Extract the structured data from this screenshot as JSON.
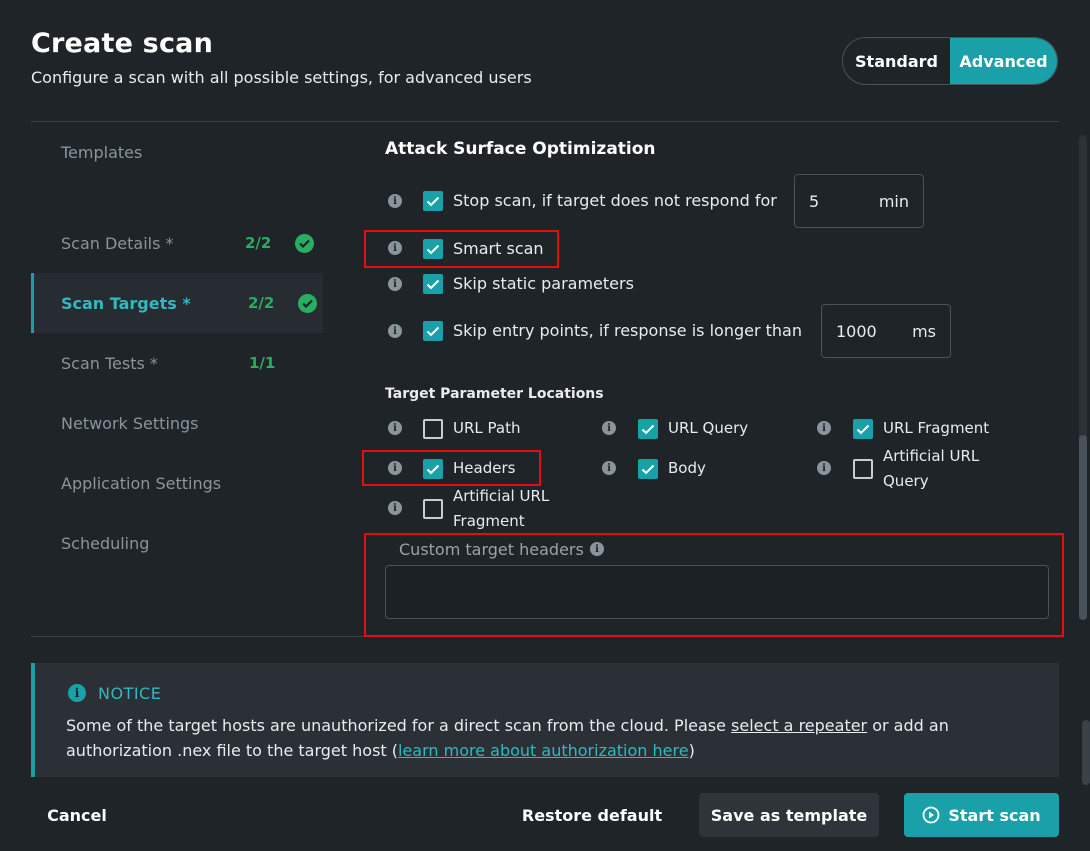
{
  "header": {
    "title": "Create scan",
    "subtitle": "Configure a scan with all possible settings, for advanced users",
    "mode_standard": "Standard",
    "mode_advanced": "Advanced",
    "active_mode": "Advanced"
  },
  "sidebar": {
    "items": [
      {
        "label": "Templates",
        "count": "",
        "complete": false,
        "active": false
      },
      {
        "label": "Scan Details *",
        "count": "2/2",
        "complete": true,
        "active": false
      },
      {
        "label": "Scan Targets *",
        "count": "2/2",
        "complete": true,
        "active": true
      },
      {
        "label": "Scan Tests *",
        "count": "1/1",
        "complete": false,
        "active": false
      },
      {
        "label": "Network Settings",
        "count": "",
        "complete": false,
        "active": false
      },
      {
        "label": "Application Settings",
        "count": "",
        "complete": false,
        "active": false
      },
      {
        "label": "Scheduling",
        "count": "",
        "complete": false,
        "active": false
      }
    ]
  },
  "main": {
    "section_title": "Attack Surface Optimization",
    "options": {
      "stop_scan": {
        "label": "Stop scan, if target does not respond for",
        "checked": true,
        "value": "5",
        "unit": "min"
      },
      "smart_scan": {
        "label": "Smart scan",
        "checked": true
      },
      "skip_static": {
        "label": "Skip static parameters",
        "checked": true
      },
      "skip_entry": {
        "label": "Skip entry points, if response is longer than",
        "checked": true,
        "value": "1000",
        "unit": "ms"
      }
    },
    "locations_title": "Target Parameter Locations",
    "locations": {
      "url_path": {
        "label": "URL Path",
        "checked": false
      },
      "url_query": {
        "label": "URL Query",
        "checked": true
      },
      "url_fragment": {
        "label": "URL Fragment",
        "checked": true
      },
      "headers": {
        "label": "Headers",
        "checked": true
      },
      "body": {
        "label": "Body",
        "checked": true
      },
      "artificial_url_query_1": "Artificial URL",
      "artificial_url_query_2": "Query",
      "artificial_url_query_checked": false,
      "artificial_url_fragment_1": "Artificial URL",
      "artificial_url_fragment_2": "Fragment",
      "artificial_url_fragment_checked": false
    },
    "custom_headers_label": "Custom target headers",
    "custom_headers_value": ""
  },
  "notice": {
    "title": "NOTICE",
    "text_1": "Some of the target hosts are unauthorized for a direct scan from the cloud. Please ",
    "link_1": "select a repeater",
    "text_2": " or add an authorization .nex file to the target host (",
    "link_2": "learn more about authorization here",
    "text_3": ")"
  },
  "footer": {
    "cancel": "Cancel",
    "restore": "Restore default",
    "save_template": "Save as template",
    "start_scan": "Start scan"
  },
  "colors": {
    "accent": "#1aa0a8",
    "success": "#27ae60",
    "highlight": "#e01010",
    "background": "#1f2428"
  },
  "icons": {
    "info": "info-icon",
    "check": "check-icon",
    "notice": "info-circle-icon",
    "play": "play-circle-icon"
  }
}
